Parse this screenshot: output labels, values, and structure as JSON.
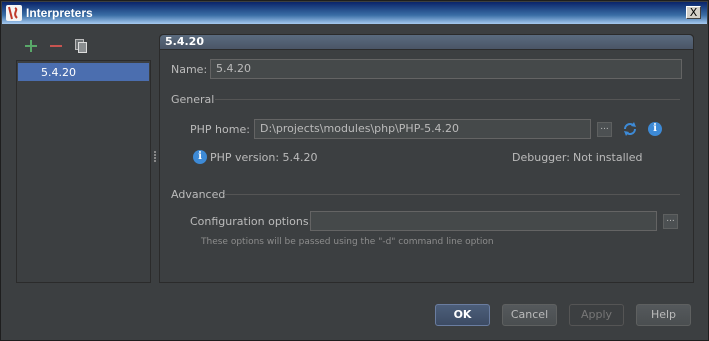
{
  "window": {
    "title": "Interpreters",
    "close_glyph": "X",
    "app_icon": "phpstorm-icon"
  },
  "toolbar": {
    "add_icon": "plus-icon",
    "remove_icon": "minus-icon",
    "copy_icon": "copy-icon"
  },
  "interpreters": [
    {
      "label": "5.4.20"
    }
  ],
  "details": {
    "header": "5.4.20",
    "name_label": "Name:",
    "name_value": "5.4.20",
    "general_label": "General",
    "php_home_label": "PHP home:",
    "php_home_value": "D:\\projects\\modules\\php\\PHP-5.4.20",
    "php_version_text": "PHP version: 5.4.20",
    "debugger_label": "Debugger:",
    "debugger_value": "Not installed",
    "advanced_label": "Advanced",
    "config_label": "Configuration options:",
    "config_value": "",
    "config_hint": "These options will be passed using the \"-d\" command line option",
    "browse_glyph": "..."
  },
  "buttons": {
    "ok": "OK",
    "cancel": "Cancel",
    "apply": "Apply",
    "help": "Help"
  },
  "colors": {
    "accent": "#4b6eaf",
    "background": "#3c3f41",
    "info": "#3d8ad6",
    "add": "#59a869",
    "remove": "#c75450"
  }
}
